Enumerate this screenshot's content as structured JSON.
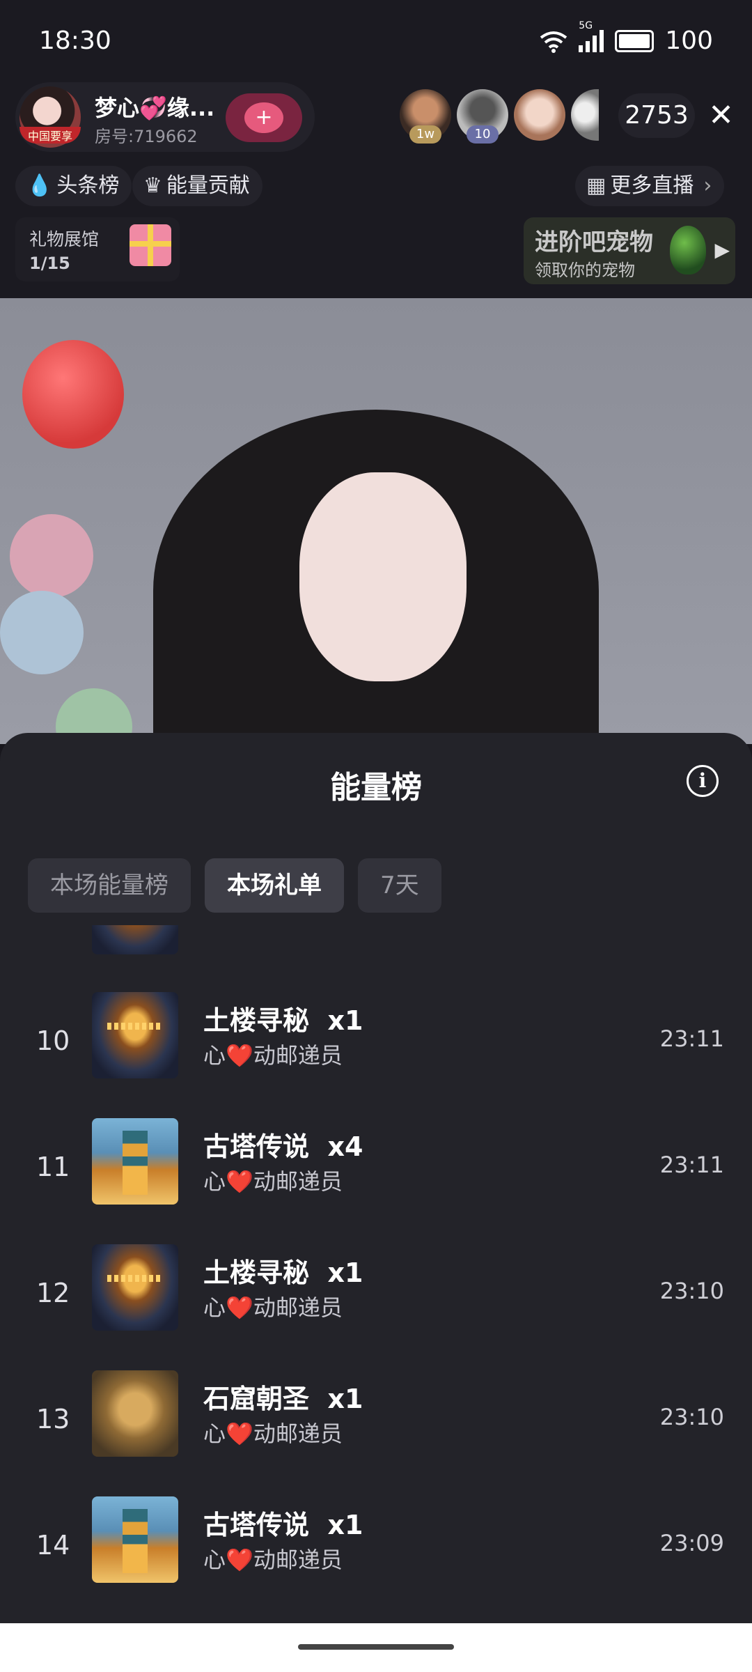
{
  "status": {
    "time": "18:30",
    "network": "5G",
    "battery": "100"
  },
  "anchor": {
    "name": "梦心💞缘...",
    "room": "房号:719662",
    "avatar_tag": "中国要享",
    "follow_icon": "+"
  },
  "viewers": {
    "badges": [
      "1w",
      "10"
    ],
    "count": "2753"
  },
  "pills": {
    "headlines": "头条榜",
    "energy_contrib": "能量贡献",
    "more_live": "更多直播"
  },
  "gift_hall": {
    "label": "礼物展馆",
    "progress": "1/15"
  },
  "pet_promo": {
    "title": "进阶吧宠物",
    "subtitle": "领取你的宠物"
  },
  "sheet": {
    "title": "能量榜",
    "tabs": [
      {
        "label": "本场能量榜",
        "active": false
      },
      {
        "label": "本场礼单",
        "active": true
      },
      {
        "label": "7天",
        "active": false
      }
    ],
    "rows": [
      {
        "rank": "10",
        "gift": "土楼寻秘",
        "qty": "x1",
        "sender_prefix": "心",
        "heart": "❤️",
        "sender_suffix": "动邮递员",
        "time": "23:11",
        "thumb": "tulou"
      },
      {
        "rank": "11",
        "gift": "古塔传说",
        "qty": "x4",
        "sender_prefix": "心",
        "heart": "❤️",
        "sender_suffix": "动邮递员",
        "time": "23:11",
        "thumb": "tower"
      },
      {
        "rank": "12",
        "gift": "土楼寻秘",
        "qty": "x1",
        "sender_prefix": "心",
        "heart": "❤️",
        "sender_suffix": "动邮递员",
        "time": "23:10",
        "thumb": "tulou"
      },
      {
        "rank": "13",
        "gift": "石窟朝圣",
        "qty": "x1",
        "sender_prefix": "心",
        "heart": "❤️",
        "sender_suffix": "动邮递员",
        "time": "23:10",
        "thumb": "buddha"
      },
      {
        "rank": "14",
        "gift": "古塔传说",
        "qty": "x1",
        "sender_prefix": "心",
        "heart": "❤️",
        "sender_suffix": "动邮递员",
        "time": "23:09",
        "thumb": "tower"
      }
    ]
  },
  "colors": {
    "background": "#18171d",
    "sheet": "#232329",
    "heart": "#e51c2b"
  }
}
